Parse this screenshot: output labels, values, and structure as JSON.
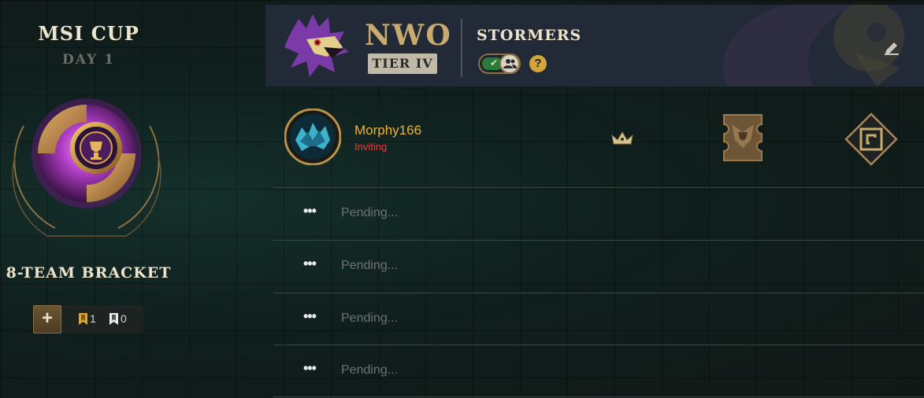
{
  "tournament": {
    "title": "MSI CUP",
    "day": "DAY 1",
    "bracket": "8-TEAM BRACKET"
  },
  "tickets": {
    "add_label": "+",
    "gold_count": "1",
    "white_count": "0"
  },
  "team": {
    "tag": "NWO",
    "tier": "TIER IV",
    "name": "STORMERS",
    "help_label": "?",
    "ready_toggle_on": true
  },
  "roster": {
    "captain": {
      "name": "Morphy166",
      "status": "Inviting"
    },
    "pending": [
      {
        "label": "Pending..."
      },
      {
        "label": "Pending..."
      },
      {
        "label": "Pending..."
      },
      {
        "label": "Pending..."
      }
    ],
    "dots_label": "•••"
  },
  "colors": {
    "gold": "#c8aa6e",
    "player_name": "#f0b232",
    "status_inviting": "#e83a3a",
    "header_bg": "#232a37"
  },
  "icons": [
    "edit-icon",
    "crown-icon",
    "ticket-icon",
    "rank-icon",
    "help-icon",
    "team-logo-icon"
  ]
}
